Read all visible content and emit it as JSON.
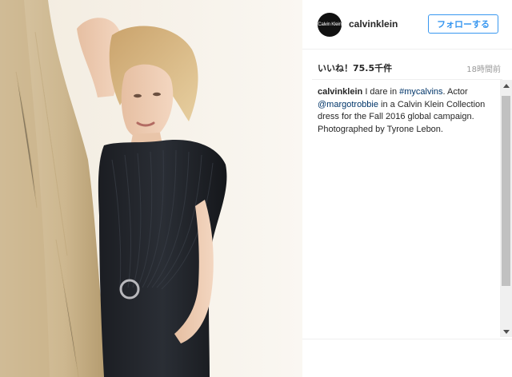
{
  "post": {
    "username": "calvinklein",
    "avatar_text": "Calvin Klein",
    "follow_label": "フォローする",
    "likes": "いいね！75.5千件",
    "time": "18時間前"
  },
  "caption": {
    "username": "calvinklein",
    "text_1": " I dare in ",
    "hashtag": "#mycalvins",
    "text_2": ". Actor ",
    "mention": "@margotrobbie",
    "text_3": " in a Calvin Klein Collection dress for the Fall 2016 global campaign. Photographed by Tyrone Lebon."
  },
  "colors": {
    "accent": "#3897f0",
    "link": "#003569",
    "text": "#262626",
    "muted": "#999999"
  }
}
